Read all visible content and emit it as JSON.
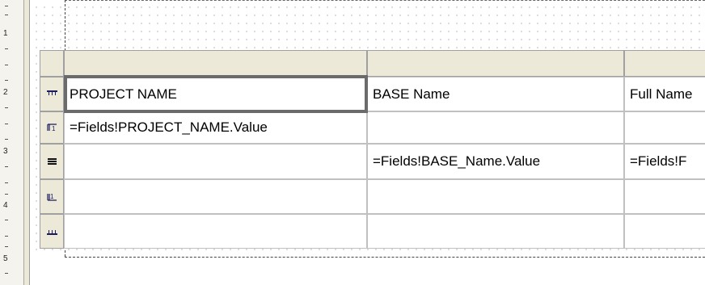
{
  "ruler": {
    "numbers": [
      "1",
      "2",
      "3",
      "4",
      "5"
    ]
  },
  "table": {
    "rows": [
      {
        "icon": "table-header-icon",
        "cells": [
          "PROJECT NAME",
          "BASE Name",
          "Full Name"
        ]
      },
      {
        "icon": "group-header-icon",
        "cells": [
          "=Fields!PROJECT_NAME.Value",
          "",
          ""
        ]
      },
      {
        "icon": "detail-row-icon",
        "cells": [
          "",
          "=Fields!BASE_Name.Value",
          "=Fields!F"
        ]
      },
      {
        "icon": "group-footer-icon",
        "cells": [
          "",
          "",
          ""
        ]
      },
      {
        "icon": "table-footer-icon",
        "cells": [
          "",
          "",
          ""
        ]
      }
    ]
  }
}
